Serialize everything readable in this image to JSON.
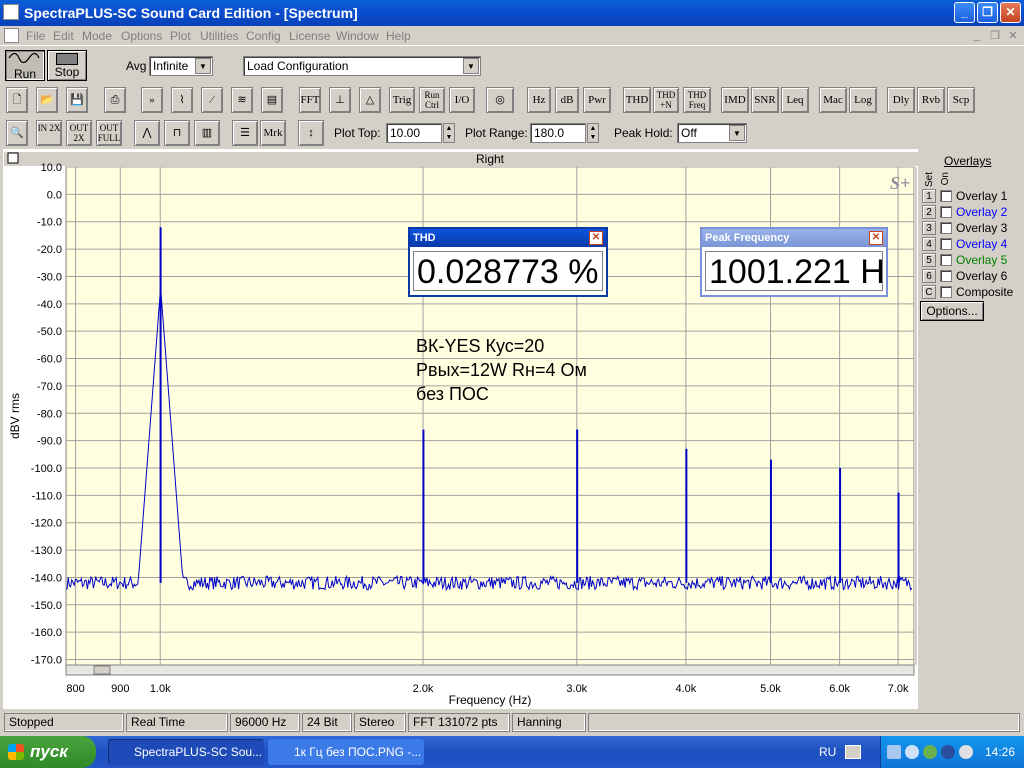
{
  "window": {
    "title": "SpectraPLUS-SC Sound Card Edition - [Spectrum]",
    "controls": {
      "minimize": "_",
      "restore": "❐",
      "close": "✕"
    }
  },
  "menu": [
    "File",
    "Edit",
    "Mode",
    "Options",
    "Plot",
    "Utilities",
    "Config",
    "License",
    "Window",
    "Help"
  ],
  "toolbar1": {
    "run_label": "Run",
    "stop_label": "Stop",
    "avg_label": "Avg",
    "avg_value": "Infinite",
    "config_value": "Load Configuration"
  },
  "toolbar2": {
    "buttons": [
      "FFT",
      "Trig",
      "Run Ctrl",
      "I/O",
      "Hz",
      "dB",
      "Pwr",
      "THD",
      "THD +N",
      "THD Freq",
      "IMD",
      "SNR",
      "Leq",
      "Mac",
      "Log",
      "Dly",
      "Rvb",
      "Scp"
    ]
  },
  "toolbar3": {
    "zoom_buttons": [
      "IN 2X",
      "OUT 2X",
      "OUT FULL"
    ],
    "mrk_label": "Mrk",
    "plot_top_label": "Plot Top:",
    "plot_top_value": "10.00",
    "plot_range_label": "Plot Range:",
    "plot_range_value": "180.0",
    "peak_hold_label": "Peak Hold:",
    "peak_hold_value": "Off"
  },
  "plot": {
    "channel_title": "Right",
    "logo": "S+",
    "annotation": [
      "ВК-YES   Кус=20",
      "Pвых=12W   Rн=4 Ом",
      "без ПОС"
    ]
  },
  "chart_data": {
    "type": "line",
    "title": "Right",
    "xlabel": "Frequency (Hz)",
    "ylabel": "dBV rms",
    "xlim": [
      780,
      7300
    ],
    "xscale": "log",
    "ylim": [
      -172,
      10
    ],
    "x_ticks": [
      800,
      900,
      1000,
      2000,
      3000,
      4000,
      5000,
      6000,
      7000
    ],
    "x_tick_labels": [
      "800",
      "900",
      "1.0k",
      "2.0k",
      "3.0k",
      "4.0k",
      "5.0k",
      "6.0k",
      "7.0k"
    ],
    "y_ticks": [
      10,
      0,
      -10,
      -20,
      -30,
      -40,
      -50,
      -60,
      -70,
      -80,
      -90,
      -100,
      -110,
      -120,
      -130,
      -140,
      -150,
      -160,
      -170
    ],
    "y_tick_labels": [
      "10.0",
      "0.0",
      "-10.0",
      "-20.0",
      "-30.0",
      "-40.0",
      "-50.0",
      "-60.0",
      "-70.0",
      "-80.0",
      "-90.0",
      "-100.0",
      "-110.0",
      "-120.0",
      "-130.0",
      "-140.0",
      "-150.0",
      "-160.0",
      "-170.0"
    ],
    "grid": true,
    "noise_floor": -142,
    "peaks": [
      {
        "x": 1001,
        "y": -12
      },
      {
        "x": 2002,
        "y": -86
      },
      {
        "x": 3003,
        "y": -86
      },
      {
        "x": 4005,
        "y": -93
      },
      {
        "x": 5006,
        "y": -97
      },
      {
        "x": 6007,
        "y": -100
      },
      {
        "x": 7008,
        "y": -109
      }
    ],
    "color": "#0000c8",
    "background": "#ffffe0"
  },
  "meters": {
    "thd": {
      "title": "THD",
      "value": "0.028773 %"
    },
    "peak_freq": {
      "title": "Peak Frequency",
      "value": "1001.221 H"
    }
  },
  "overlays": {
    "title": "Overlays",
    "col_set": "Set",
    "col_on": "On",
    "items": [
      {
        "num": "1",
        "label": "Overlay 1",
        "color": "#000000"
      },
      {
        "num": "2",
        "label": "Overlay 2",
        "color": "#0000ff"
      },
      {
        "num": "3",
        "label": "Overlay 3",
        "color": "#000000"
      },
      {
        "num": "4",
        "label": "Overlay 4",
        "color": "#0000ff"
      },
      {
        "num": "5",
        "label": "Overlay 5",
        "color": "#008000"
      },
      {
        "num": "6",
        "label": "Overlay 6",
        "color": "#000000"
      },
      {
        "num": "C",
        "label": "Composite",
        "color": "#000000"
      }
    ],
    "options_label": "Options..."
  },
  "status": [
    "Stopped",
    "Real Time",
    "96000 Hz",
    "24 Bit",
    "Stereo",
    "FFT 131072 pts",
    "Hanning"
  ],
  "taskbar": {
    "start_label": "пуск",
    "tasks": [
      "SpectraPLUS-SC Sou...",
      "1к Гц без ПОС.PNG -..."
    ],
    "lang": "RU",
    "clock": "14:26"
  }
}
